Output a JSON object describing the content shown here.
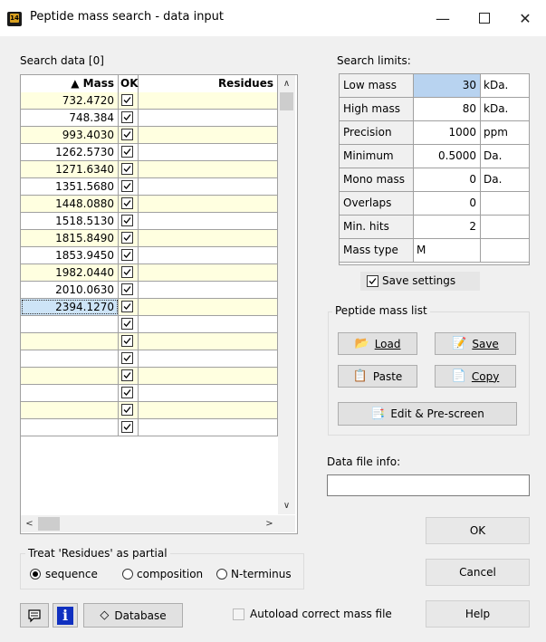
{
  "window": {
    "title": "Peptide mass search - data input",
    "icon_text": "14"
  },
  "search_data": {
    "label": "Search data [0]",
    "columns": {
      "mass": "▲ Mass",
      "ok": "OK",
      "residues": "Residues"
    },
    "rows": [
      {
        "mass": "732.4720",
        "ok": true
      },
      {
        "mass": "748.384",
        "ok": true
      },
      {
        "mass": "993.4030",
        "ok": true
      },
      {
        "mass": "1262.5730",
        "ok": true
      },
      {
        "mass": "1271.6340",
        "ok": true
      },
      {
        "mass": "1351.5680",
        "ok": true
      },
      {
        "mass": "1448.0880",
        "ok": true
      },
      {
        "mass": "1518.5130",
        "ok": true
      },
      {
        "mass": "1815.8490",
        "ok": true
      },
      {
        "mass": "1853.9450",
        "ok": true
      },
      {
        "mass": "1982.0440",
        "ok": true
      },
      {
        "mass": "2010.0630",
        "ok": true
      },
      {
        "mass": "2394.1270",
        "ok": true,
        "selected": true
      },
      {
        "mass": "",
        "ok": true
      },
      {
        "mass": "",
        "ok": true
      },
      {
        "mass": "",
        "ok": true
      },
      {
        "mass": "",
        "ok": true
      },
      {
        "mass": "",
        "ok": true
      },
      {
        "mass": "",
        "ok": true
      },
      {
        "mass": "",
        "ok": true
      }
    ]
  },
  "search_limits": {
    "label": "Search limits:",
    "rows": [
      {
        "name": "Low mass",
        "value": "30",
        "unit": "kDa."
      },
      {
        "name": "High mass",
        "value": "80",
        "unit": "kDa."
      },
      {
        "name": "Precision",
        "value": "1000",
        "unit": "ppm"
      },
      {
        "name": "Minimum",
        "value": "0.5000",
        "unit": "Da."
      },
      {
        "name": "Mono mass",
        "value": "0",
        "unit": "Da."
      },
      {
        "name": "Overlaps",
        "value": "0",
        "unit": ""
      },
      {
        "name": "Min. hits",
        "value": "2",
        "unit": ""
      },
      {
        "name": "Mass type",
        "value": "M",
        "unit": ""
      }
    ],
    "save_settings": "Save settings"
  },
  "peptide_mass_list": {
    "title": "Peptide mass list",
    "load": "Load",
    "save": "Save",
    "paste": "Paste",
    "copy": "Copy",
    "edit": "Edit & Pre-screen"
  },
  "data_file_info": {
    "label": "Data file info:",
    "value": ""
  },
  "residues_mode": {
    "title": "Treat 'Residues' as partial",
    "options": [
      "sequence",
      "composition",
      "N-terminus"
    ],
    "selected": "sequence"
  },
  "bottom": {
    "database": "Database",
    "autoload": "Autoload correct mass file",
    "ok": "OK",
    "cancel": "Cancel",
    "help": "Help"
  },
  "colors": {
    "row_tint": "#ffffe0",
    "selected_cell": "#cde4f7",
    "low_mass_value": "#b8d3f0"
  }
}
